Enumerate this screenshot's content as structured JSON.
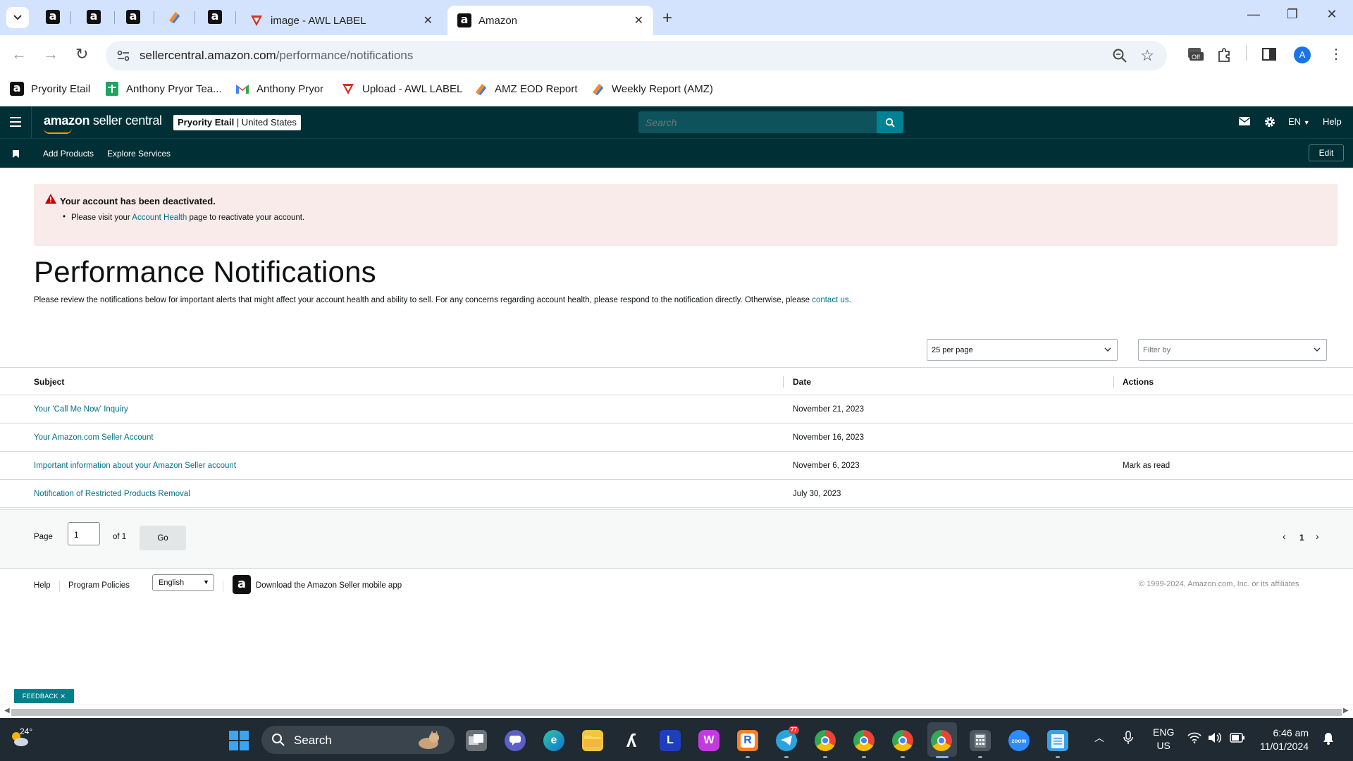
{
  "browser": {
    "tabs": [
      {
        "label": "image - AWL LABEL",
        "close": "✕"
      },
      {
        "label": "Amazon",
        "close": "✕"
      }
    ],
    "new_tab": "+",
    "url_domain": "sellercentral.amazon.com",
    "url_path": "/performance/notifications",
    "profile_initial": "A",
    "bookmarks": [
      "Pryority Etail",
      "Anthony Pryor Tea...",
      "Anthony Pryor",
      "Upload - AWL LABEL",
      "AMZ EOD Report",
      "Weekly Report (AMZ)"
    ]
  },
  "header": {
    "logo_bold": "amazon",
    "logo_rest": " seller central",
    "store_name": "Pryority Etail",
    "store_region": " | United States",
    "search_placeholder": "Search",
    "language": "EN",
    "help": "Help"
  },
  "subnav": {
    "links": [
      "Add Products",
      "Explore Services"
    ],
    "edit": "Edit"
  },
  "alert": {
    "title": "Your account has been deactivated.",
    "msg_before": "Please visit your ",
    "msg_link": "Account Health",
    "msg_after": " page to reactivate your account."
  },
  "page": {
    "title": "Performance Notifications",
    "intro": "Please review the notifications below for important alerts that might affect your account health and ability to sell. For any concerns regarding account health, please respond to the notification directly. Otherwise, please ",
    "intro_link": "contact us",
    "intro_end": "."
  },
  "controls": {
    "per_page": "25 per page",
    "filter": "Filter by"
  },
  "table": {
    "headers": [
      "Subject",
      "Date",
      "Actions"
    ],
    "rows": [
      {
        "subject": "Your 'Call Me Now' Inquiry",
        "date": "November 21, 2023",
        "action": ""
      },
      {
        "subject": "Your Amazon.com Seller Account",
        "date": "November 16, 2023",
        "action": ""
      },
      {
        "subject": "Important information about your Amazon Seller account",
        "date": "November 6, 2023",
        "action": "Mark as read"
      },
      {
        "subject": "Notification of Restricted Products Removal",
        "date": "July 30, 2023",
        "action": ""
      }
    ]
  },
  "pager": {
    "page_label": "Page",
    "page_value": "1",
    "of_label": "of 1",
    "go": "Go",
    "current": "1"
  },
  "footer": {
    "help": "Help",
    "policies": "Program Policies",
    "language": "English",
    "app": "Download the Amazon Seller mobile app",
    "copyright": "© 1999-2024, Amazon.com, Inc. or its affiliates"
  },
  "feedback": "FEEDBACK ✕",
  "taskbar": {
    "temperature": "24°",
    "search": "Search",
    "telegram_badge": "77",
    "lang_top": "ENG",
    "lang_bottom": "US",
    "time": "6:46 am",
    "date": "11/01/2024"
  },
  "colors": {
    "header_bg": "#002f36",
    "link": "#007185",
    "alert_bg": "#f9ebea",
    "chrome_tabstrip": "#d3e3fd"
  }
}
